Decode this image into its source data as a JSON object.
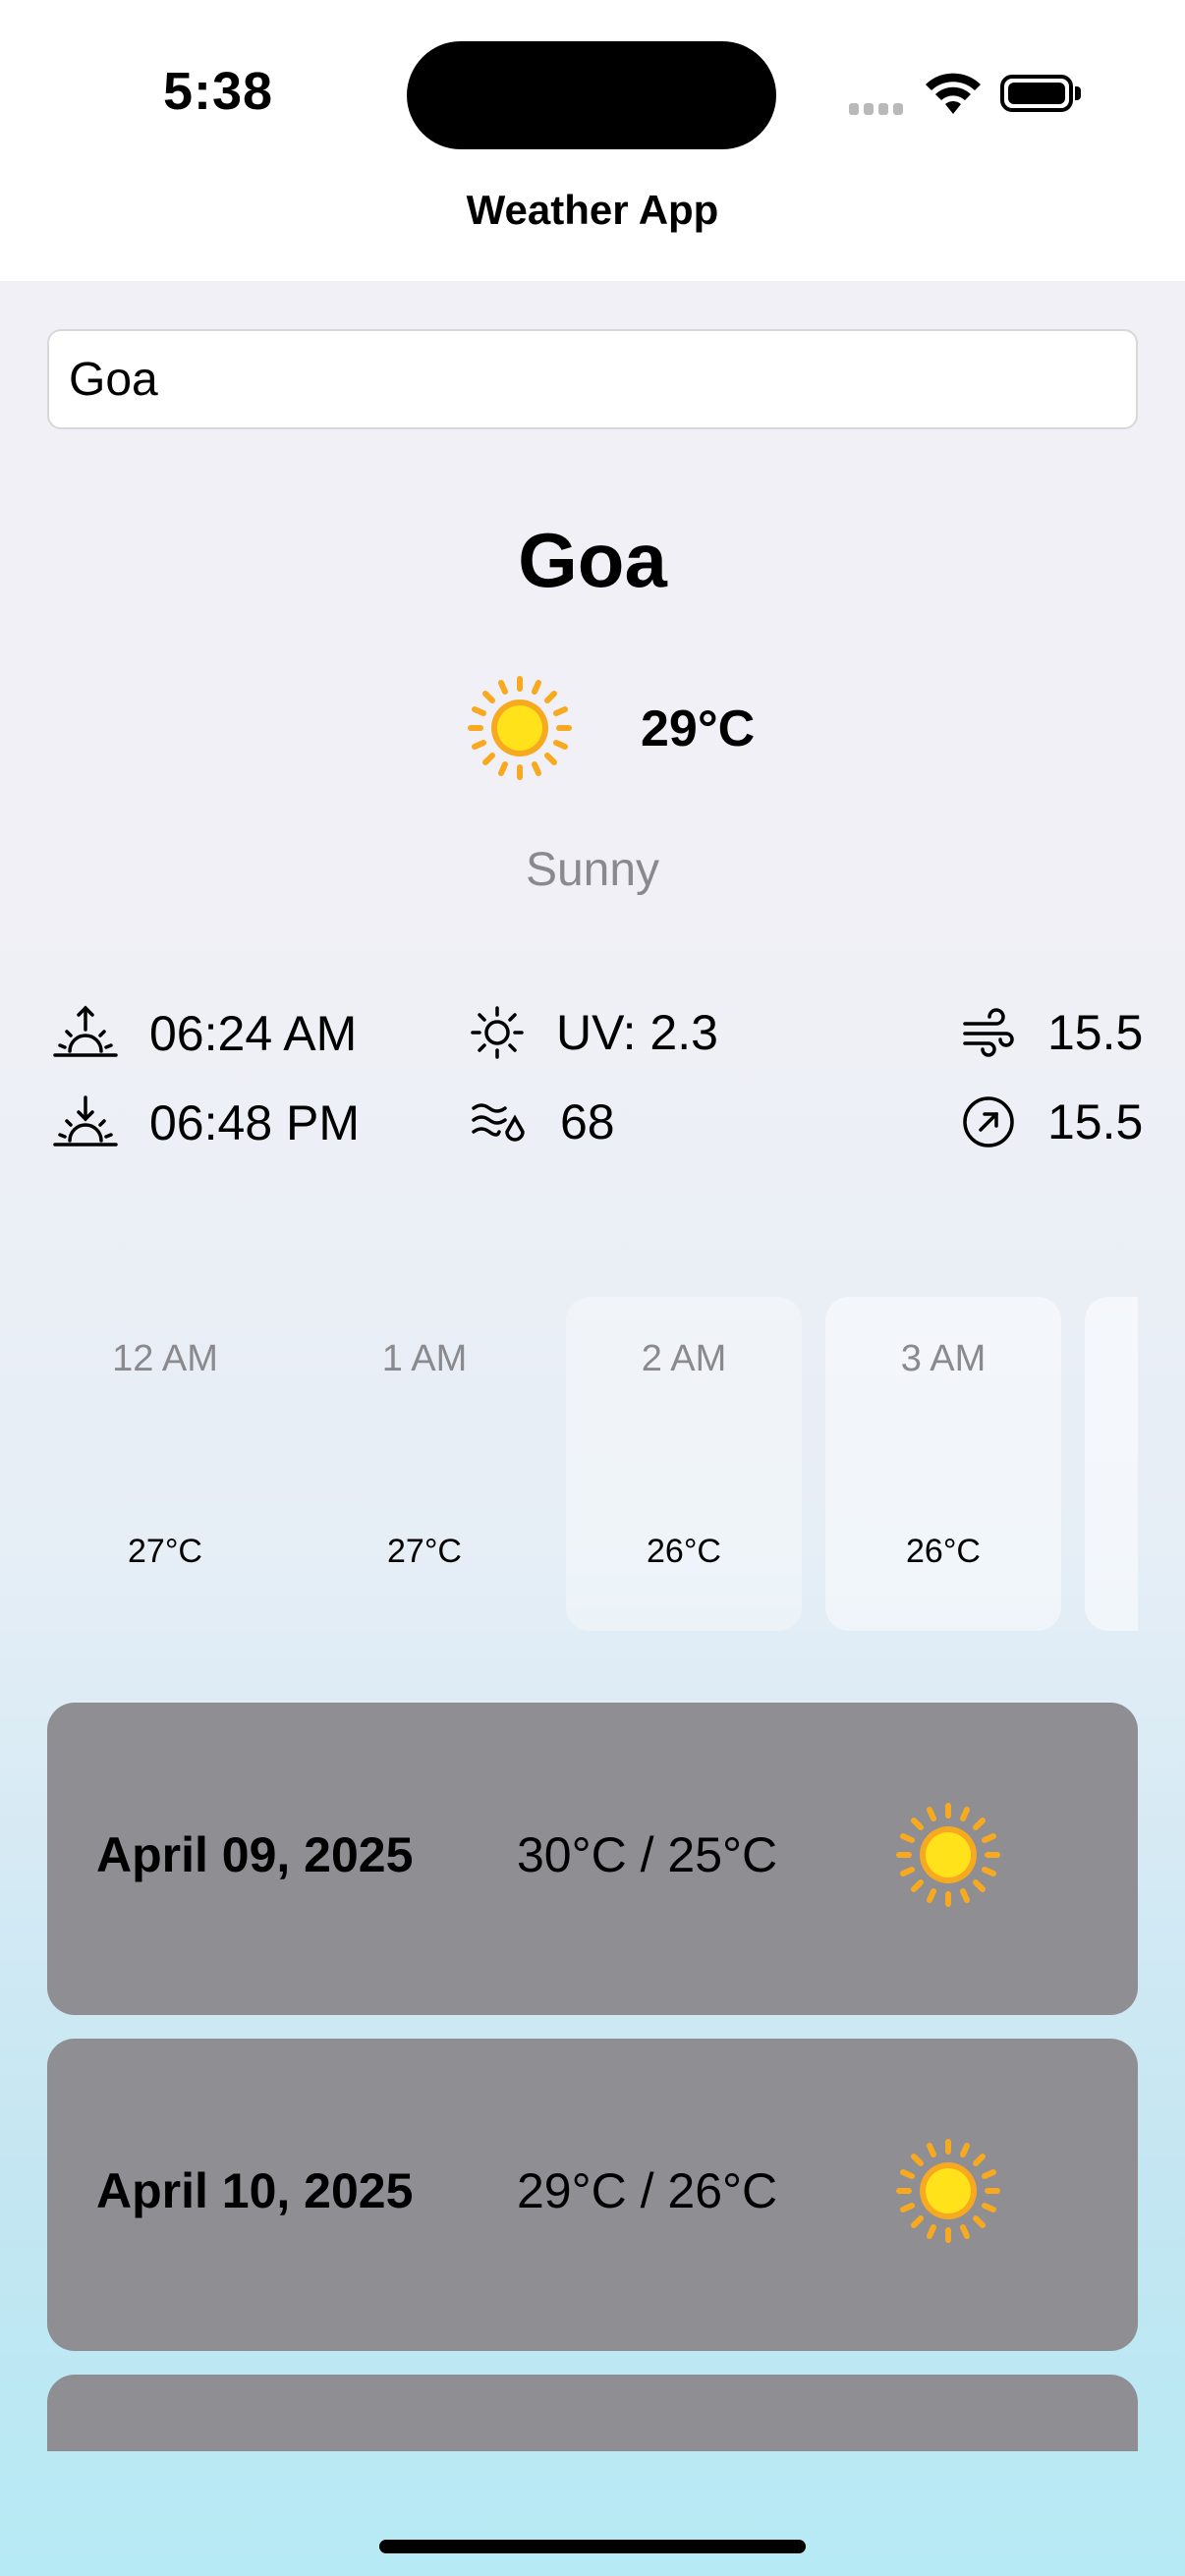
{
  "status_bar": {
    "time": "5:38"
  },
  "nav": {
    "title": "Weather App"
  },
  "search": {
    "value": "Goa"
  },
  "current": {
    "city": "Goa",
    "temperature": "29°C",
    "condition": "Sunny",
    "condition_icon": "sun-icon"
  },
  "details": {
    "sunrise": "06:24 AM",
    "sunset": "06:48 PM",
    "uv": "UV: 2.3",
    "humidity": "68",
    "wind": "15.5",
    "gust": "15.5"
  },
  "hourly": [
    {
      "hour": "12 AM",
      "icon": "moon-icon",
      "temp": "27°C"
    },
    {
      "hour": "1 AM",
      "icon": "moon-icon",
      "temp": "27°C"
    },
    {
      "hour": "2 AM",
      "icon": "moon-icon",
      "temp": "26°C"
    },
    {
      "hour": "3 AM",
      "icon": "moon-icon",
      "temp": "26°C"
    }
  ],
  "daily": [
    {
      "date": "April 09, 2025",
      "range": "30°C / 25°C",
      "icon": "sun-icon"
    },
    {
      "date": "April 10, 2025",
      "range": "29°C / 26°C",
      "icon": "sun-icon"
    }
  ],
  "colors": {
    "card": "#8e8e93",
    "moon": "#1a73d8",
    "sun": "#ffd21f",
    "sun_ray": "#f7a91f"
  }
}
